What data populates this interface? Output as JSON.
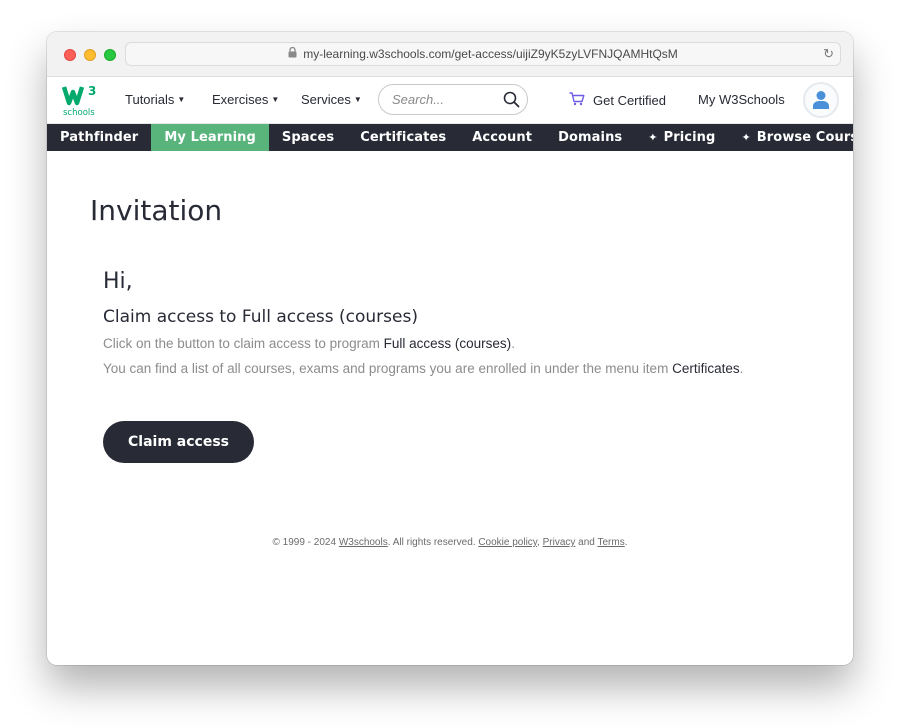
{
  "browser": {
    "url": "my-learning.w3schools.com/get-access/uijiZ9yK5zyLVFNJQAMHtQsM"
  },
  "topnav": {
    "logo_text": "schools",
    "logo_superscript": "3",
    "tutorials": "Tutorials",
    "exercises": "Exercises",
    "services": "Services",
    "search_placeholder": "Search...",
    "get_certified": "Get Certified",
    "my_w3schools": "My W3Schools"
  },
  "subnav": {
    "items": [
      {
        "label": "Pathfinder",
        "active": false
      },
      {
        "label": "My Learning",
        "active": true
      },
      {
        "label": "Spaces",
        "active": false
      },
      {
        "label": "Certificates",
        "active": false
      },
      {
        "label": "Account",
        "active": false
      },
      {
        "label": "Domains",
        "active": false
      },
      {
        "label": "Pricing",
        "active": false
      },
      {
        "label": "Browse Courses & Exams",
        "active": false
      }
    ]
  },
  "main": {
    "title": "Invitation",
    "greeting": "Hi,",
    "heading": "Claim access to Full access (courses)",
    "line1_prefix": "Click on the button to claim access to program ",
    "line1_program": "Full access (courses)",
    "line1_suffix": ".",
    "line2_prefix": "You can find a list of all courses, exams and programs you are enrolled in under the menu item ",
    "line2_item": "Certificates",
    "line2_suffix": ".",
    "claim_button": "Claim access"
  },
  "footer": {
    "prefix": "© 1999 - 2024 ",
    "w3schools": "W3schools",
    "rights": ". All rights reserved. ",
    "cookie_policy": "Cookie policy",
    "comma": ", ",
    "privacy": "Privacy",
    "and": " and ",
    "terms": "Terms",
    "end": "."
  },
  "colors": {
    "dark": "#282a35",
    "accent_green": "#59b47c",
    "cart_purple": "#6f5ce6"
  }
}
